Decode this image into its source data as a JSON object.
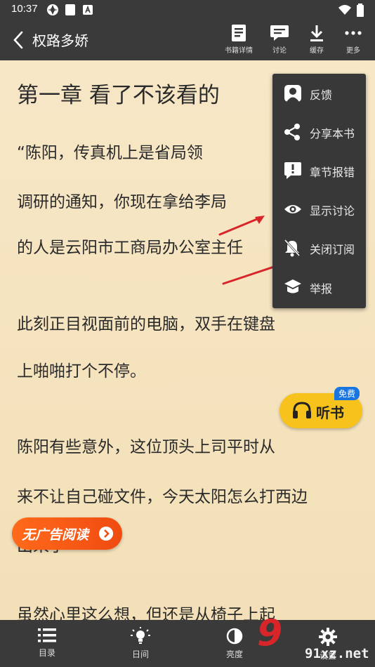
{
  "status_bar": {
    "time": "10:37"
  },
  "top_bar": {
    "title": "权路多娇",
    "actions": [
      {
        "label": "书籍详情",
        "icon": "book-details-icon"
      },
      {
        "label": "讨论",
        "icon": "discussion-icon"
      },
      {
        "label": "缓存",
        "icon": "download-icon"
      },
      {
        "label": "更多",
        "icon": "more-icon"
      }
    ]
  },
  "reader": {
    "chapter_title": "第一章 看了不该看的",
    "lines": [
      "    “陈阳，传真机上是省局领",
      "调研的通知，你现在拿给李局",
      "的人是云阳市工商局办公室主任",
      "    此刻正目视面前的电脑，双手在键盘",
      "上啪啪打个不停。",
      "    陈阳有些意外，这位顶头上司平时从",
      "来不让自己碰文件，今天太阳怎么打西边",
      "出来了",
      "    虽然心里这么想，但还是从椅子上起"
    ]
  },
  "more_menu": {
    "items": [
      {
        "label": "反馈",
        "icon": "feedback-icon"
      },
      {
        "label": "分享本书",
        "icon": "share-icon"
      },
      {
        "label": "章节报错",
        "icon": "report-error-icon"
      },
      {
        "label": "显示讨论",
        "icon": "eye-icon"
      },
      {
        "label": "关闭订阅",
        "icon": "bell-off-icon"
      },
      {
        "label": "举报",
        "icon": "report-icon"
      }
    ]
  },
  "listen_button": {
    "label": "听书",
    "badge": "免费"
  },
  "ad_free_button": {
    "label": "无广告阅读"
  },
  "bottom_bar": {
    "items": [
      {
        "label": "目录",
        "icon": "list-icon"
      },
      {
        "label": "日间",
        "icon": "lightbulb-icon"
      },
      {
        "label": "亮度",
        "icon": "brightness-icon"
      },
      {
        "label": "设置",
        "icon": "gear-icon"
      }
    ]
  },
  "watermark": {
    "number": "9",
    "domain": "91xz.net"
  },
  "colors": {
    "bar": "#3a3a3a",
    "paper": "#f6e6c2",
    "menu": "#383838",
    "accent_yellow": "#f6c21b",
    "accent_orange": "#f04b12",
    "badge_blue": "#1976e0",
    "arrow_red": "#d8252a"
  }
}
